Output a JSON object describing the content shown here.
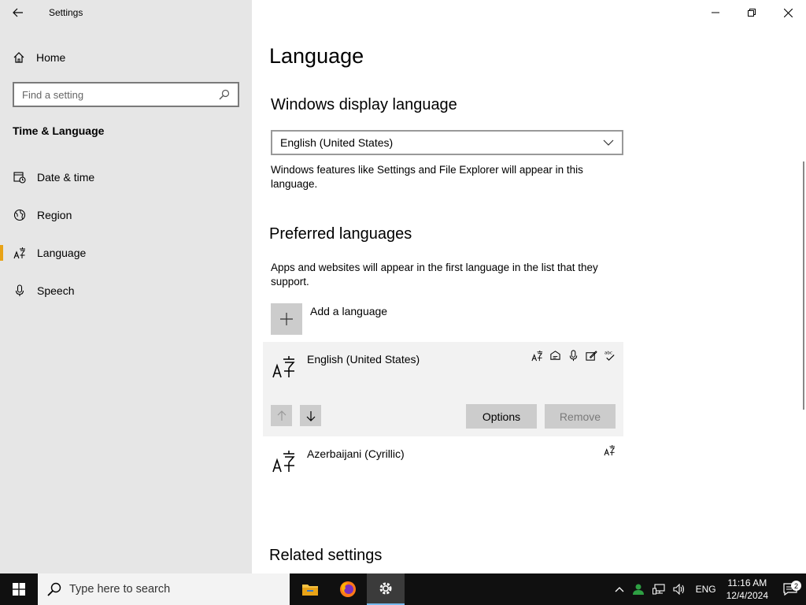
{
  "window": {
    "app_title": "Settings"
  },
  "sidebar": {
    "home_label": "Home",
    "search_placeholder": "Find a setting",
    "section_title": "Time & Language",
    "items": [
      {
        "label": "Date & time"
      },
      {
        "label": "Region"
      },
      {
        "label": "Language",
        "active": true
      },
      {
        "label": "Speech"
      }
    ]
  },
  "main": {
    "page_title": "Language",
    "display_language": {
      "heading": "Windows display language",
      "selected": "English (United States)",
      "description": "Windows features like Settings and File Explorer will appear in this language."
    },
    "preferred": {
      "heading": "Preferred languages",
      "description": "Apps and websites will appear in the first language in the list that they support.",
      "add_label": "Add a language",
      "languages": [
        {
          "name": "English (United States)"
        },
        {
          "name": "Azerbaijani (Cyrillic)"
        }
      ],
      "options_label": "Options",
      "remove_label": "Remove"
    },
    "related_heading": "Related settings"
  },
  "taskbar": {
    "search_placeholder": "Type here to search",
    "language_indicator": "ENG",
    "time": "11:16 AM",
    "date": "12/4/2024",
    "notification_count": "2"
  },
  "colors": {
    "accent": "#e8a317",
    "sidebar_bg": "#e6e6e6",
    "taskbar_bg": "#101010"
  }
}
